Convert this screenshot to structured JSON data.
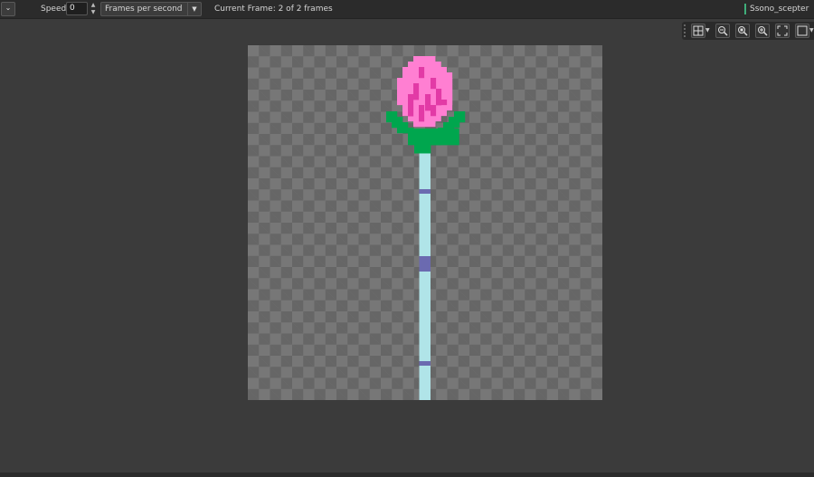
{
  "toolbar": {
    "menu_caret": "⌄",
    "speed_label": "Speed:",
    "speed_value": "0",
    "speed_unit": "Frames per second",
    "current_frame": "Current Frame: 2 of 2 frames",
    "sprite_name": "Ssono_scepter"
  },
  "view_tools": [
    {
      "name": "grid-toggle-icon"
    },
    {
      "name": "zoom-out-icon"
    },
    {
      "name": "zoom-reset-icon"
    },
    {
      "name": "zoom-in-icon"
    },
    {
      "name": "fullscreen-icon"
    },
    {
      "name": "background-toggle-icon"
    }
  ],
  "colors": {
    "petal_light": "#ff7fd2",
    "petal_dark": "#e23aa6",
    "leaf": "#00a64e",
    "staff": "#b0e4e8",
    "band": "#6b6ab0"
  }
}
